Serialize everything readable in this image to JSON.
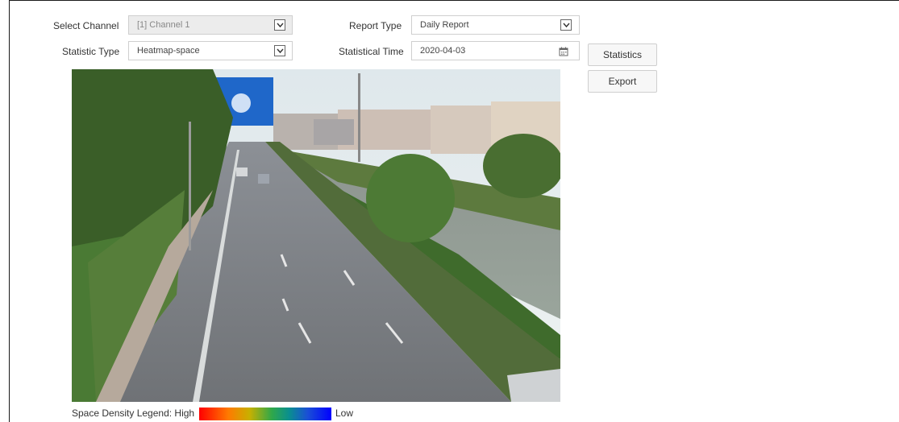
{
  "filters": {
    "select_channel_label": "Select Channel",
    "select_channel_value": "[1] Channel 1",
    "report_type_label": "Report Type",
    "report_type_value": "Daily Report",
    "statistic_type_label": "Statistic Type",
    "statistic_type_value": "Heatmap-space",
    "statistical_time_label": "Statistical Time",
    "statistical_time_value": "2020-04-03"
  },
  "actions": {
    "statistics_label": "Statistics",
    "export_label": "Export"
  },
  "legend": {
    "label": "Space Density Legend: High",
    "low_label": "Low",
    "high_color": "#ff0000",
    "low_color": "#0000ff"
  },
  "icons": {
    "dropdown": "chevron-down-icon",
    "date": "calendar-icon"
  }
}
